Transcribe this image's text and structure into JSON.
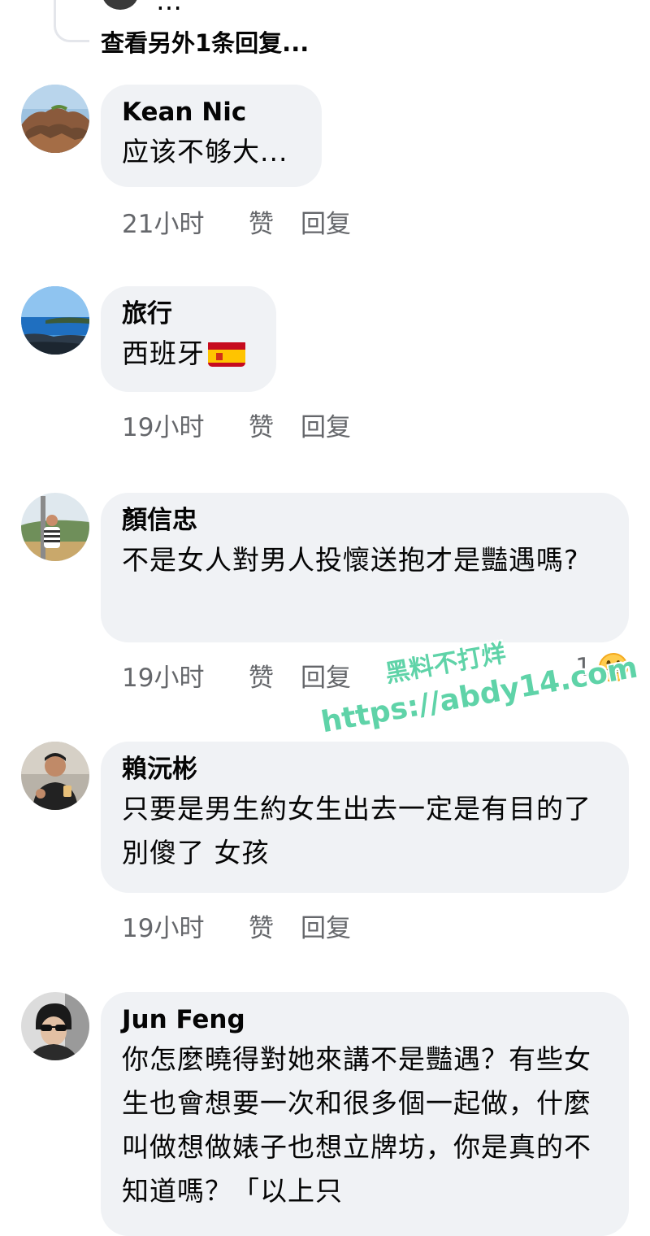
{
  "thread": {
    "previous_reply_clipped": "…",
    "more_replies": "查看另外1条回复..."
  },
  "comments": [
    {
      "author": "Kean Nic",
      "text": "应该不够大...",
      "time": "21小时",
      "like": "赞",
      "reply": "回复",
      "avatar": "rocky-coast-photo"
    },
    {
      "author": "旅行",
      "text": "西班牙",
      "flag": "spain-flag-emoji",
      "time": "19小时",
      "like": "赞",
      "reply": "回复",
      "avatar": "sea-coast-photo"
    },
    {
      "author": "顏信忠",
      "text": "不是女人對男人投懷送抱才是豔遇嗎?",
      "time": "19小时",
      "like": "赞",
      "reply": "回复",
      "reaction_count": "1",
      "reaction_emoji": "grinning-face-emoji",
      "avatar": "man-outdoor-photo"
    },
    {
      "author": "賴沅彬",
      "text": "只要是男生約女生出去一定是有目的了 別傻了 女孩",
      "time": "19小时",
      "like": "赞",
      "reply": "回复",
      "avatar": "man-drinking-photo"
    },
    {
      "author": "Jun Feng",
      "text": "你怎麼曉得對她來講不是豔遇？有些女生也會想要一次和很多個一起做，什麼叫做想做婊子也想立牌坊，你是真的不知道嗎？「以上只",
      "avatar": "man-sunglasses-photo"
    }
  ],
  "watermark": {
    "line1": "黑料不打烊",
    "line2": "https://abdy14.com"
  },
  "colors": {
    "bubble": "#f0f2f5",
    "meta_text": "#65676b",
    "watermark": "#5fd3a8"
  }
}
